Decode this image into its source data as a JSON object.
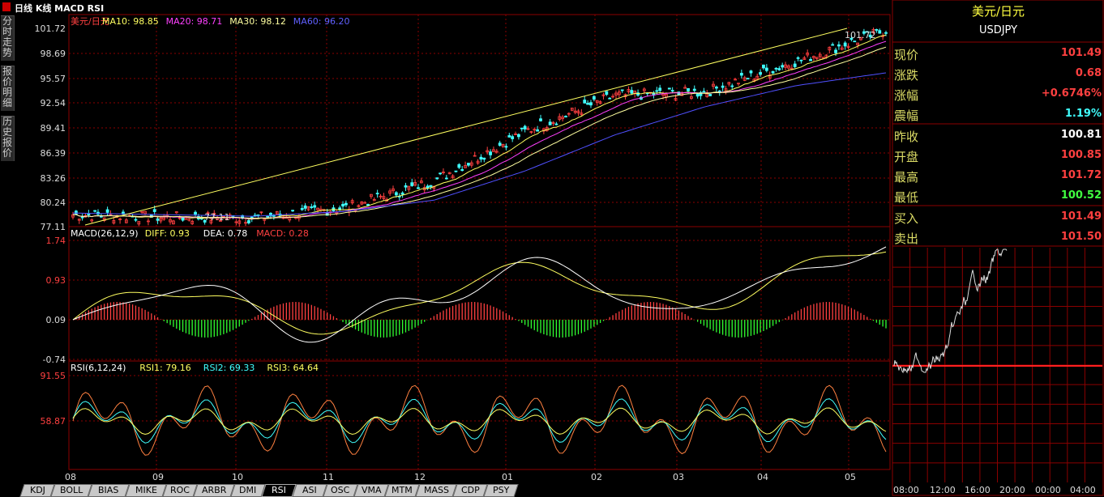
{
  "toolbar": {
    "title": "日线 K线 MACD RSI"
  },
  "vtabs": [
    {
      "label": "分时走势"
    },
    {
      "label": "报价明细"
    },
    {
      "label": "历史报价"
    }
  ],
  "colors": {
    "up": "#ff4040",
    "down": "#40ffff",
    "ma10": "#ffff60",
    "ma20": "#ff40ff",
    "ma30": "#ffffa0",
    "ma60": "#5050ff",
    "grid": "#8b0000"
  },
  "kline": {
    "legend": [
      {
        "text": "美元/日元",
        "color": "#ff4040"
      },
      {
        "text": "MA10: 98.85",
        "color": "#ffff60"
      },
      {
        "text": "MA20: 98.71",
        "color": "#ff40ff"
      },
      {
        "text": "MA30: 98.12",
        "color": "#ffffa0"
      },
      {
        "text": "MA60: 96.20",
        "color": "#6060ff"
      }
    ],
    "yticks": [
      "101.72",
      "98.69",
      "95.57",
      "92.54",
      "89.41",
      "86.39",
      "83.26",
      "80.24",
      "77.11"
    ],
    "high_label": "101.72",
    "low_label": "77.11"
  },
  "macd": {
    "legend": [
      {
        "text": "MACD(26,12,9)",
        "color": "#ffffff"
      },
      {
        "text": "DIFF: 0.93",
        "color": "#ffff60"
      },
      {
        "text": "DEA: 0.78",
        "color": "#ffffff"
      },
      {
        "text": "MACD: 0.28",
        "color": "#ff4040"
      }
    ],
    "yticks": [
      "1.74",
      "0.93",
      "0.09",
      "-0.74"
    ]
  },
  "rsi": {
    "legend": [
      {
        "text": "RSI(6,12,24)",
        "color": "#ffffff"
      },
      {
        "text": "RSI1: 79.16",
        "color": "#ffff60"
      },
      {
        "text": "RSI2: 69.33",
        "color": "#40ffff"
      },
      {
        "text": "RSI3: 64.64",
        "color": "#ffff60"
      }
    ],
    "yticks": [
      "91.55",
      "58.87"
    ]
  },
  "xaxis": [
    "08",
    "09",
    "10",
    "11",
    "12",
    "01",
    "02",
    "03",
    "04",
    "05"
  ],
  "chart_data": {
    "type": "line",
    "title": "美元/日元",
    "x": [
      "08",
      "09",
      "10",
      "11",
      "12",
      "01",
      "02",
      "03",
      "04",
      "05"
    ],
    "series": [
      {
        "name": "美元/日元",
        "values": [
          78.6,
          78.3,
          78.2,
          79.4,
          82.8,
          88.9,
          93.4,
          93.8,
          97.6,
          101.5
        ]
      },
      {
        "name": "MA60",
        "values": [
          78.8,
          78.6,
          78.4,
          79.0,
          80.4,
          84.0,
          88.5,
          92.0,
          94.6,
          96.2
        ]
      }
    ],
    "ylim": [
      77.11,
      101.72
    ]
  },
  "quote": {
    "title": "美元/日元",
    "code": "USDJPY",
    "rows": [
      {
        "label": "现价",
        "value": "101.49",
        "color": "#ff4040"
      },
      {
        "label": "涨跌",
        "value": "0.68",
        "color": "#ff4040"
      },
      {
        "label": "涨幅",
        "value": "+0.6746%",
        "color": "#ff4040"
      },
      {
        "label": "震幅",
        "value": "1.19%",
        "color": "#40ffff"
      },
      {
        "label": "昨收",
        "value": "100.81",
        "color": "#ffffff"
      },
      {
        "label": "开盘",
        "value": "100.85",
        "color": "#ff4040"
      },
      {
        "label": "最高",
        "value": "101.72",
        "color": "#ff4040"
      },
      {
        "label": "最低",
        "value": "100.52",
        "color": "#40ff40"
      },
      {
        "label": "买入",
        "value": "101.49",
        "color": "#ff4040"
      },
      {
        "label": "卖出",
        "value": "101.50",
        "color": "#ff4040"
      }
    ]
  },
  "mini": {
    "xticks": [
      "08:00",
      "12:00",
      "16:00",
      "20:00",
      "00:00",
      "04:00"
    ]
  },
  "bottom_tabs": [
    "KDJ",
    "BOLL",
    "BIAS",
    "MIKE",
    "ROC",
    "ARBR",
    "DMI",
    "RSI",
    "ASI",
    "OSC",
    "VMA",
    "MTM",
    "MASS",
    "CDP",
    "PSY"
  ],
  "active_tab": "RSI"
}
